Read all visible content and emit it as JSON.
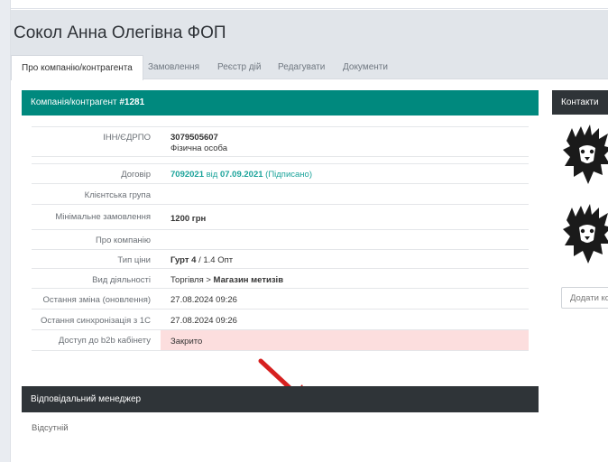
{
  "page": {
    "title": "Сокол Анна Олегівна ФОП"
  },
  "tabs": [
    {
      "label": "Про компанію/контрагента",
      "active": true
    },
    {
      "label": "Замовлення"
    },
    {
      "label": "Реєстр дій"
    },
    {
      "label": "Редагувати"
    },
    {
      "label": "Документи"
    }
  ],
  "company": {
    "header_label": "Компанія/контрагент",
    "number": "#1281",
    "rows": {
      "inn": {
        "label": "ІНН/ЄДРПО",
        "value": "3079505607",
        "subvalue": "Фізична особа"
      },
      "contract": {
        "label": "Договір",
        "number": "7092021",
        "from_text": "від",
        "date": "07.09.2021",
        "status": "(Підписано)"
      },
      "client_group": {
        "label": "Клієнтська група",
        "value": ""
      },
      "min_order": {
        "label": "Мінімальне замовлення",
        "value": "1200 грн"
      },
      "about": {
        "label": "Про компанію",
        "value": ""
      },
      "price_type": {
        "label": "Тип ціни",
        "value_bold": "Гурт 4",
        "value_rest": " / 1.4 Опт"
      },
      "activity": {
        "label": "Вид діяльності",
        "value": "Торгівля > ",
        "value_bold": "Магазин метизів"
      },
      "last_change": {
        "label": "Остання зміна (оновлення)",
        "value": "27.08.2024 09:26"
      },
      "last_sync": {
        "label": "Остання синхронізація з 1С",
        "value": "27.08.2024 09:26"
      },
      "b2b_access": {
        "label": "Доступ до b2b кабінету",
        "value": "Закрито"
      }
    }
  },
  "manager": {
    "header_label": "Відповідальний менеджер",
    "value": "Відсутній"
  },
  "contacts": {
    "header_label": "Контакти",
    "add_label": "Додати ко"
  },
  "colors": {
    "accent": "#00897e",
    "dark": "#2f3438",
    "link": "#1aa39a",
    "closed_bg": "#fcdede",
    "arrow": "#d6201f"
  }
}
